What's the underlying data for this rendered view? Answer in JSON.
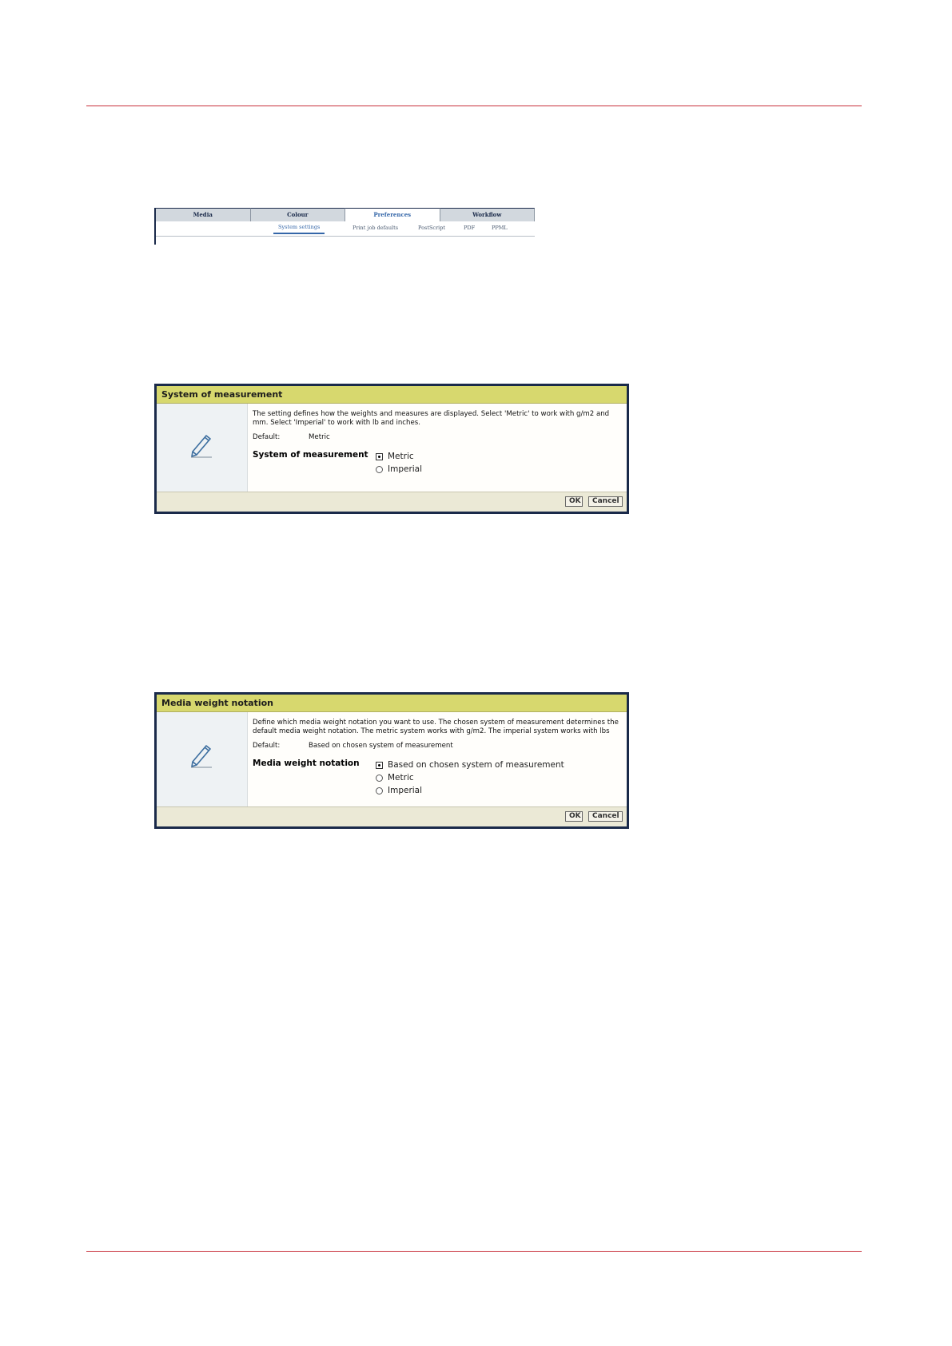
{
  "tabbar": {
    "tabs": [
      {
        "label": "Media"
      },
      {
        "label": "Colour"
      },
      {
        "label": "Preferences",
        "active": true
      },
      {
        "label": "Workflow"
      }
    ],
    "subtabs": [
      {
        "label": "System settings",
        "active": true
      },
      {
        "label": "Print job defaults"
      },
      {
        "label": "PostScript"
      },
      {
        "label": "PDF"
      },
      {
        "label": "PPML"
      }
    ]
  },
  "dialog_measurement": {
    "title": "System of measurement",
    "description": "The setting defines how the weights and measures are displayed. Select 'Metric' to work with g/m2 and mm. Select 'Imperial' to work with lb and inches.",
    "default_label": "Default:",
    "default_value": "Metric",
    "setting_label": "System of measurement",
    "options": [
      {
        "label": "Metric",
        "selected": true
      },
      {
        "label": "Imperial",
        "selected": false
      }
    ],
    "ok_label": "OK",
    "cancel_label": "Cancel"
  },
  "dialog_weight": {
    "title": "Media weight notation",
    "description": "Define which media weight notation you want to use. The chosen system of measurement determines the default media weight notation. The metric system works with g/m2. The imperial system works with lbs",
    "default_label": "Default:",
    "default_value": "Based on chosen system of measurement",
    "setting_label": "Media weight notation",
    "options": [
      {
        "label": "Based on chosen system of measurement",
        "selected": true
      },
      {
        "label": "Metric",
        "selected": false
      },
      {
        "label": "Imperial",
        "selected": false
      }
    ],
    "ok_label": "OK",
    "cancel_label": "Cancel"
  },
  "colors": {
    "rule": "#c8323c",
    "dialog_title_bg": "#d7d86e",
    "dialog_border": "#1a2a4a",
    "active_tab_text": "#3466a8"
  },
  "icons": {
    "dialog_icon": "pencil-icon"
  }
}
